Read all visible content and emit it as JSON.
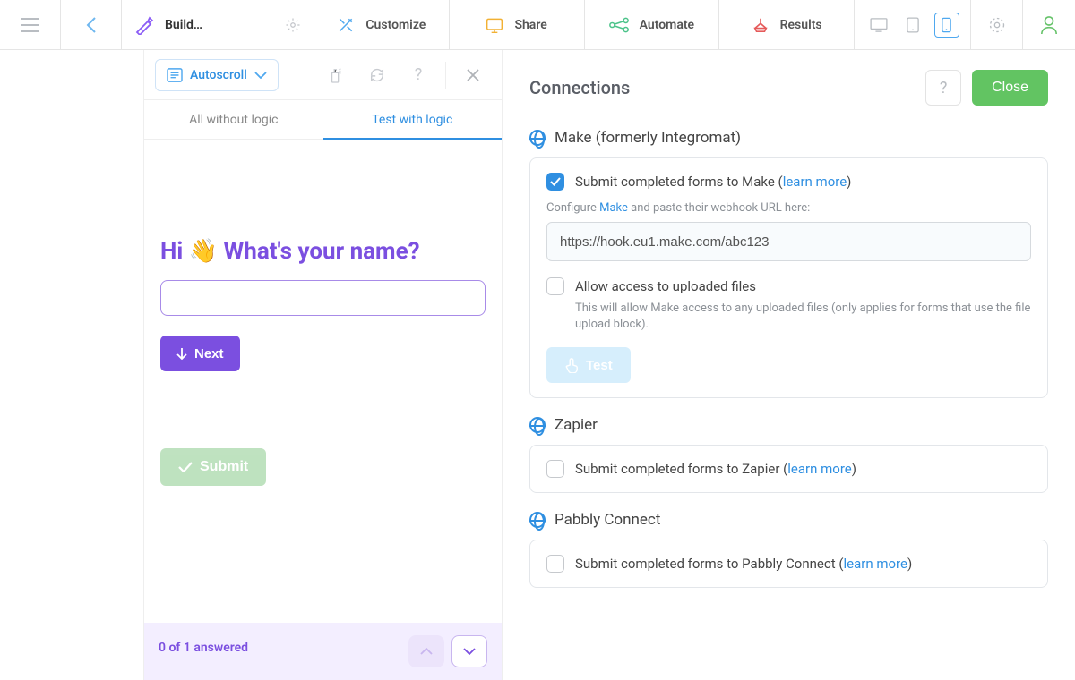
{
  "topnav": {
    "build_label": "Build…",
    "customize_label": "Customize",
    "share_label": "Share",
    "automate_label": "Automate",
    "results_label": "Results"
  },
  "previewToolbar": {
    "autoscroll_label": "Autoscroll"
  },
  "previewTabs": {
    "all_without_logic": "All without logic",
    "test_with_logic": "Test with logic"
  },
  "preview": {
    "question": "Hi 👋 What's your name?",
    "next_label": "Next",
    "submit_label": "Submit"
  },
  "progress": {
    "text": "0 of 1 answered"
  },
  "panel": {
    "title": "Connections",
    "close_label": "Close",
    "sections": {
      "make": {
        "title": "Make (formerly Integromat)",
        "submit_label_pre": "Submit completed forms to Make (",
        "learn_more": "learn more",
        "submit_label_post": ")",
        "configure_pre": "Configure ",
        "configure_link": "Make",
        "configure_post": " and paste their webhook URL here:",
        "webhook_value": "https://hook.eu1.make.com/abc123",
        "allow_upload_label": "Allow access to uploaded files",
        "allow_upload_hint": "This will allow Make access to any uploaded files (only applies for forms that use the file upload block).",
        "test_label": "Test"
      },
      "zapier": {
        "title": "Zapier",
        "submit_label_pre": "Submit completed forms to Zapier (",
        "learn_more": "learn more",
        "submit_label_post": ")"
      },
      "pabbly": {
        "title": "Pabbly Connect",
        "submit_label_pre": "Submit completed forms to Pabbly Connect (",
        "learn_more": "learn more",
        "submit_label_post": ")"
      }
    }
  }
}
